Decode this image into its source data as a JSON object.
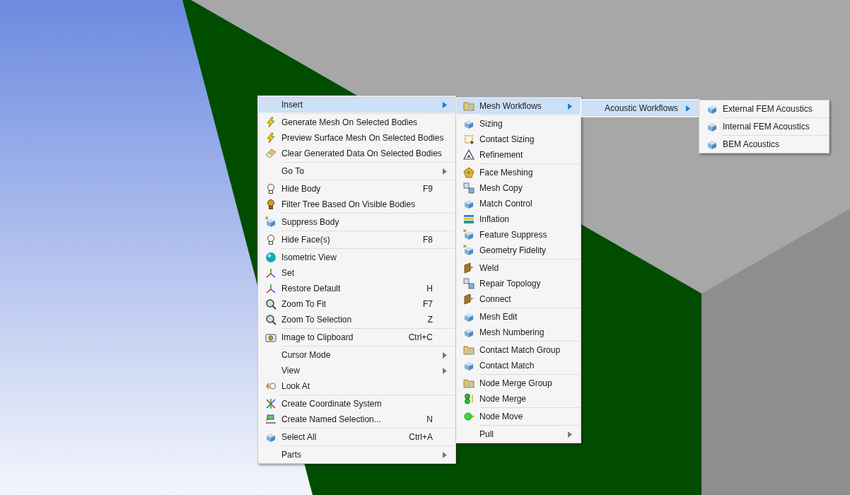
{
  "menus": [
    {
      "groups": [
        [
          {
            "label": "Insert",
            "submenu": true,
            "selected": true
          }
        ],
        [
          {
            "label": "Generate Mesh On Selected Bodies",
            "submenu": false,
            "selected": false
          },
          {
            "label": "Preview Surface Mesh On Selected Bodies",
            "submenu": false,
            "selected": false
          },
          {
            "label": "Clear Generated Data On Selected Bodies",
            "submenu": false,
            "selected": false
          }
        ],
        [
          {
            "label": "Go To",
            "submenu": true,
            "selected": false
          }
        ],
        [
          {
            "label": "Hide Body",
            "shortcut": "F9",
            "submenu": false,
            "selected": false
          },
          {
            "label": "Filter Tree Based On Visible Bodies",
            "submenu": false,
            "selected": false
          }
        ],
        [
          {
            "label": "Suppress Body",
            "submenu": false,
            "selected": false
          }
        ],
        [
          {
            "label": "Hide Face(s)",
            "shortcut": "F8",
            "submenu": false,
            "selected": false
          }
        ],
        [
          {
            "label": "Isometric View",
            "submenu": false,
            "selected": false
          },
          {
            "label": "Set",
            "submenu": false,
            "selected": false
          },
          {
            "label": "Restore Default",
            "shortcut": "H",
            "submenu": false,
            "selected": false
          },
          {
            "label": "Zoom To Fit",
            "shortcut": "F7",
            "submenu": false,
            "selected": false
          },
          {
            "label": "Zoom To Selection",
            "shortcut": "Z",
            "submenu": false,
            "selected": false
          }
        ],
        [
          {
            "label": "Image to Clipboard",
            "shortcut": "Ctrl+C",
            "submenu": false,
            "selected": false
          }
        ],
        [
          {
            "label": "Cursor Mode",
            "submenu": true,
            "selected": false
          },
          {
            "label": "View",
            "submenu": true,
            "selected": false
          },
          {
            "label": "Look At",
            "submenu": false,
            "selected": false
          }
        ],
        [
          {
            "label": "Create Coordinate System",
            "submenu": false,
            "selected": false
          },
          {
            "label": "Create Named Selection...",
            "shortcut": "N",
            "submenu": false,
            "selected": false
          }
        ],
        [
          {
            "label": "Select All",
            "shortcut": "Ctrl+A",
            "submenu": false,
            "selected": false
          }
        ],
        [
          {
            "label": "Parts",
            "submenu": true,
            "selected": false
          }
        ]
      ]
    },
    {
      "groups": [
        [
          {
            "label": "Mesh Workflows",
            "submenu": true,
            "selected": true
          }
        ],
        [
          {
            "label": "Sizing",
            "submenu": false,
            "selected": false
          },
          {
            "label": "Contact Sizing",
            "submenu": false,
            "selected": false
          },
          {
            "label": "Refinement",
            "submenu": false,
            "selected": false
          }
        ],
        [
          {
            "label": "Face Meshing",
            "submenu": false,
            "selected": false
          },
          {
            "label": "Mesh Copy",
            "submenu": false,
            "selected": false
          },
          {
            "label": "Match Control",
            "submenu": false,
            "selected": false
          },
          {
            "label": "Inflation",
            "submenu": false,
            "selected": false
          },
          {
            "label": "Feature Suppress",
            "submenu": false,
            "selected": false
          },
          {
            "label": "Geometry Fidelity",
            "submenu": false,
            "selected": false
          }
        ],
        [
          {
            "label": "Weld",
            "submenu": false,
            "selected": false
          },
          {
            "label": "Repair Topology",
            "submenu": false,
            "selected": false
          },
          {
            "label": "Connect",
            "submenu": false,
            "selected": false
          }
        ],
        [
          {
            "label": "Mesh Edit",
            "submenu": false,
            "selected": false
          },
          {
            "label": "Mesh Numbering",
            "submenu": false,
            "selected": false
          }
        ],
        [
          {
            "label": "Contact Match Group",
            "submenu": false,
            "selected": false
          },
          {
            "label": "Contact Match",
            "submenu": false,
            "selected": false
          }
        ],
        [
          {
            "label": "Node Merge Group",
            "submenu": false,
            "selected": false
          },
          {
            "label": "Node Merge",
            "submenu": false,
            "selected": false
          }
        ],
        [
          {
            "label": "Node Move",
            "submenu": false,
            "selected": false
          }
        ],
        [
          {
            "label": "Pull",
            "submenu": true,
            "selected": false
          }
        ]
      ]
    },
    {
      "groups": [
        [
          {
            "label": "Acoustic Workflows",
            "submenu": true,
            "selected": true
          }
        ]
      ]
    },
    {
      "groups": [
        [
          {
            "label": "External FEM Acoustics",
            "submenu": false,
            "selected": false
          }
        ],
        [
          {
            "label": "Internal FEM Acoustics",
            "submenu": false,
            "selected": false
          }
        ],
        [
          {
            "label": "BEM Acoustics",
            "submenu": false,
            "selected": false
          }
        ]
      ]
    }
  ]
}
